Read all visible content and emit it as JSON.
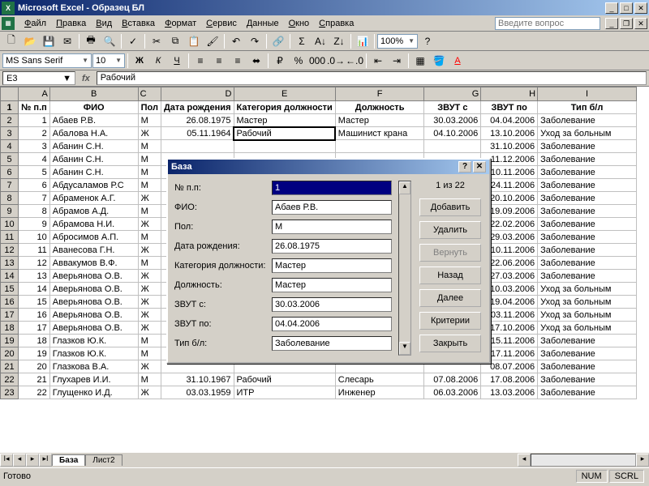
{
  "titlebar": {
    "title": "Microsoft Excel - Образец БЛ"
  },
  "menu": [
    "Файл",
    "Правка",
    "Вид",
    "Вставка",
    "Формат",
    "Сервис",
    "Данные",
    "Окно",
    "Справка"
  ],
  "ask_placeholder": "Введите вопрос",
  "font": {
    "name": "MS Sans Serif",
    "size": "10"
  },
  "zoom": "100%",
  "namebox": "E3",
  "formula": "Рабочий",
  "col_letters": [
    "A",
    "B",
    "C",
    "D",
    "E",
    "F",
    "G",
    "H",
    "I"
  ],
  "headers": [
    "№ п.п",
    "ФИО",
    "Пол",
    "Дата рождения",
    "Категория должности",
    "Должность",
    "ЗВУТ с",
    "ЗВУТ по",
    "Тип б/л"
  ],
  "rows": [
    {
      "n": "1",
      "fio": "Абаев Р.В.",
      "pol": "М",
      "dr": "26.08.1975",
      "kat": "Мастер",
      "dol": "Мастер",
      "s": "30.03.2006",
      "po": "04.04.2006",
      "tip": "Заболевание"
    },
    {
      "n": "2",
      "fio": "Абалова Н.А.",
      "pol": "Ж",
      "dr": "05.11.1964",
      "kat": "Рабочий",
      "dol": "Машинист крана",
      "s": "04.10.2006",
      "po": "13.10.2006",
      "tip": "Уход за больным"
    },
    {
      "n": "3",
      "fio": "Абанин С.Н.",
      "pol": "М",
      "dr": "",
      "kat": "",
      "dol": "",
      "s": "",
      "po": "31.10.2006",
      "tip": "Заболевание"
    },
    {
      "n": "4",
      "fio": "Абанин С.Н.",
      "pol": "М",
      "dr": "",
      "kat": "",
      "dol": "",
      "s": "",
      "po": "11.12.2006",
      "tip": "Заболевание"
    },
    {
      "n": "5",
      "fio": "Абанин С.Н.",
      "pol": "М",
      "dr": "",
      "kat": "",
      "dol": "",
      "s": "",
      "po": "10.11.2006",
      "tip": "Заболевание"
    },
    {
      "n": "6",
      "fio": "Абдусаламов Р.С",
      "pol": "М",
      "dr": "",
      "kat": "",
      "dol": "",
      "s": "",
      "po": "24.11.2006",
      "tip": "Заболевание"
    },
    {
      "n": "7",
      "fio": "Абраменок А.Г.",
      "pol": "Ж",
      "dr": "",
      "kat": "",
      "dol": "",
      "s": "",
      "po": "20.10.2006",
      "tip": "Заболевание"
    },
    {
      "n": "8",
      "fio": "Абрамов А.Д.",
      "pol": "М",
      "dr": "",
      "kat": "",
      "dol": "",
      "s": "",
      "po": "19.09.2006",
      "tip": "Заболевание"
    },
    {
      "n": "9",
      "fio": "Абрамова Н.И.",
      "pol": "Ж",
      "dr": "",
      "kat": "",
      "dol": "",
      "s": "",
      "po": "22.02.2006",
      "tip": "Заболевание"
    },
    {
      "n": "10",
      "fio": "Абросимов А.П.",
      "pol": "М",
      "dr": "",
      "kat": "",
      "dol": "",
      "s": "",
      "po": "29.03.2006",
      "tip": "Заболевание"
    },
    {
      "n": "11",
      "fio": "Аванесова Г.Н.",
      "pol": "Ж",
      "dr": "",
      "kat": "",
      "dol": "",
      "s": "",
      "po": "10.11.2006",
      "tip": "Заболевание"
    },
    {
      "n": "12",
      "fio": "Аввакумов В.Ф.",
      "pol": "М",
      "dr": "",
      "kat": "",
      "dol": "",
      "s": "",
      "po": "22.06.2006",
      "tip": "Заболевание"
    },
    {
      "n": "13",
      "fio": "Аверьянова О.В.",
      "pol": "Ж",
      "dr": "",
      "kat": "",
      "dol": "",
      "s": "",
      "po": "27.03.2006",
      "tip": "Заболевание"
    },
    {
      "n": "14",
      "fio": "Аверьянова О.В.",
      "pol": "Ж",
      "dr": "",
      "kat": "",
      "dol": "",
      "s": "",
      "po": "10.03.2006",
      "tip": "Уход за больным"
    },
    {
      "n": "15",
      "fio": "Аверьянова О.В.",
      "pol": "Ж",
      "dr": "",
      "kat": "",
      "dol": "",
      "s": "",
      "po": "19.04.2006",
      "tip": "Уход за больным"
    },
    {
      "n": "16",
      "fio": "Аверьянова О.В.",
      "pol": "Ж",
      "dr": "",
      "kat": "",
      "dol": "",
      "s": "",
      "po": "03.11.2006",
      "tip": "Уход за больным"
    },
    {
      "n": "17",
      "fio": "Аверьянова О.В.",
      "pol": "Ж",
      "dr": "",
      "kat": "",
      "dol": "",
      "s": "",
      "po": "17.10.2006",
      "tip": "Уход за больным"
    },
    {
      "n": "18",
      "fio": "Глазков Ю.К.",
      "pol": "М",
      "dr": "",
      "kat": "",
      "dol": "",
      "s": "",
      "po": "15.11.2006",
      "tip": "Заболевание"
    },
    {
      "n": "19",
      "fio": "Глазков Ю.К.",
      "pol": "М",
      "dr": "",
      "kat": "",
      "dol": "",
      "s": "",
      "po": "17.11.2006",
      "tip": "Заболевание"
    },
    {
      "n": "20",
      "fio": "Глазкова В.А.",
      "pol": "Ж",
      "dr": "",
      "kat": "",
      "dol": "",
      "s": "",
      "po": "08.07.2006",
      "tip": "Заболевание"
    },
    {
      "n": "21",
      "fio": "Глухарев И.И.",
      "pol": "М",
      "dr": "31.10.1967",
      "kat": "Рабочий",
      "dol": "Слесарь",
      "s": "07.08.2006",
      "po": "17.08.2006",
      "tip": "Заболевание"
    },
    {
      "n": "22",
      "fio": "Глущенко И.Д.",
      "pol": "Ж",
      "dr": "03.03.1959",
      "kat": "ИТР",
      "dol": "Инженер",
      "s": "06.03.2006",
      "po": "13.03.2006",
      "tip": "Заболевание"
    }
  ],
  "sheets": {
    "active": "База",
    "other": "Лист2"
  },
  "status": {
    "ready": "Готово",
    "num": "NUM",
    "scrl": "SCRL"
  },
  "dialog": {
    "title": "База",
    "counter": "1 из 22",
    "fields": {
      "npp": {
        "label": "№ п.п:",
        "value": "1"
      },
      "fio": {
        "label": "ФИО:",
        "value": "Абаев Р.В."
      },
      "pol": {
        "label": "Пол:",
        "value": "М"
      },
      "dr": {
        "label": "Дата рождения:",
        "value": "26.08.1975"
      },
      "kat": {
        "label": "Категория должности:",
        "value": "Мастер"
      },
      "dol": {
        "label": "Должность:",
        "value": "Мастер"
      },
      "s": {
        "label": "ЗВУТ с:",
        "value": "30.03.2006"
      },
      "po": {
        "label": "ЗВУТ по:",
        "value": "04.04.2006"
      },
      "tip": {
        "label": "Тип б/л:",
        "value": "Заболевание"
      }
    },
    "buttons": {
      "add": "Добавить",
      "del": "Удалить",
      "restore": "Вернуть",
      "prev": "Назад",
      "next": "Далее",
      "criteria": "Критерии",
      "close": "Закрыть"
    }
  }
}
